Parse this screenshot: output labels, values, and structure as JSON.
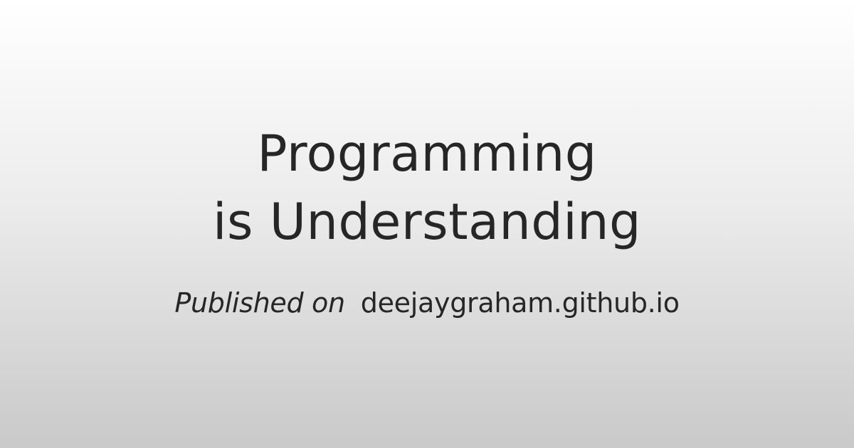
{
  "title": {
    "line1": "Programming",
    "line2": "is Understanding"
  },
  "byline": {
    "prefix": "Published on",
    "site": "deejaygraham.github.io"
  },
  "colors": {
    "text": "#262626",
    "background_top": "#ffffff",
    "background_bottom": "#c9c9c9"
  }
}
